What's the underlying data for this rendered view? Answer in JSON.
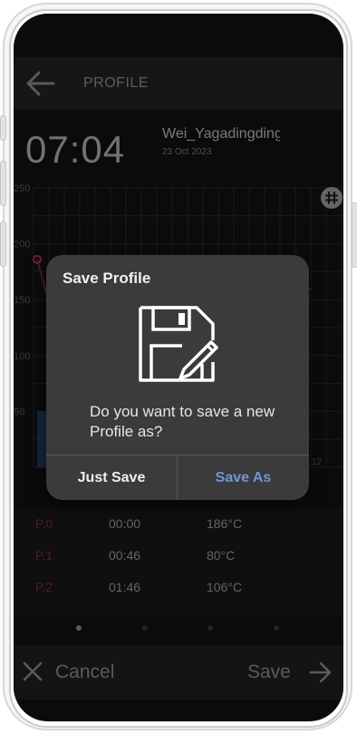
{
  "header": {
    "title": "PROFILE"
  },
  "summary": {
    "time": "07:04",
    "user": "Wei_Yagadingding",
    "date": "23 Oct 2023"
  },
  "chart_data": {
    "type": "line",
    "y_ticks": [
      "250",
      "200",
      "150",
      "100",
      "50"
    ],
    "x_tick_visible": "12",
    "ylim": [
      0,
      250
    ],
    "grid": true
  },
  "points": [
    {
      "label": "P.0",
      "time": "00:00",
      "temp": "186°C"
    },
    {
      "label": "P.1",
      "time": "00:46",
      "temp": "80°C"
    },
    {
      "label": "P.2",
      "time": "01:46",
      "temp": "106°C"
    }
  ],
  "pager": {
    "count": 4,
    "active": 0
  },
  "footer": {
    "cancel_label": "Cancel",
    "save_label": "Save"
  },
  "modal": {
    "title": "Save Profile",
    "message": "Do you want to save a new Profile as?",
    "just_save_label": "Just Save",
    "save_as_label": "Save As"
  },
  "colors": {
    "accent_blue": "#6f97d4",
    "point_red": "#7a2838",
    "background": "#121212"
  },
  "icons": {
    "back": "arrow-left-icon",
    "hash": "hash-icon",
    "floppy": "floppy-disk-edit-icon",
    "cancel": "close-icon",
    "save": "arrow-right-icon"
  }
}
